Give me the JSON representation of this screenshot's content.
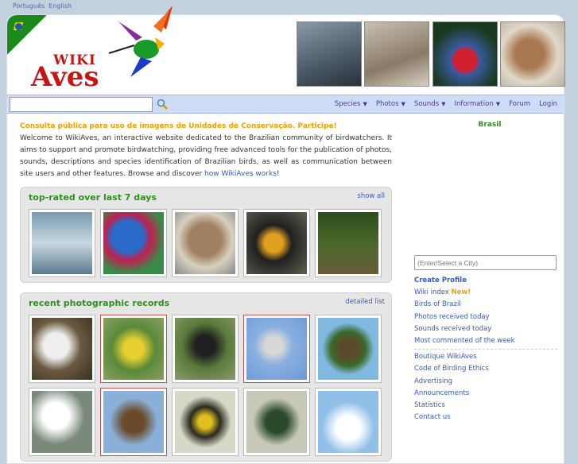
{
  "languages": [
    "Português",
    "English"
  ],
  "logo": {
    "wiki": "WIKI",
    "aves": "Aves"
  },
  "search": {
    "placeholder": ""
  },
  "nav": [
    {
      "label": "Species",
      "dropdown": true
    },
    {
      "label": "Photos",
      "dropdown": true
    },
    {
      "label": "Sounds",
      "dropdown": true
    },
    {
      "label": "Information",
      "dropdown": true
    },
    {
      "label": "Forum",
      "dropdown": false
    },
    {
      "label": "Login",
      "dropdown": false
    }
  ],
  "notice": "Consulta pública para uso de imagens de Unidades de Conservação. Participe!",
  "intro": {
    "text": "Welcome to WikiAves, an interactive website dedicated to the Brazilian community of birdwatchers. It aims to support and promote birdwatching, providing free advanced tools for the publication of photos, sounds, descriptions and species identification of Brazilian birds, as well as communication between site users and other features. Browse and discover ",
    "link": "how WikiAves works",
    "end": "!"
  },
  "top_rated": {
    "title": "top-rated over last 7 days",
    "more": "show all"
  },
  "recent": {
    "title": "recent photographic records",
    "more": "detailed list"
  },
  "right": {
    "region": "Brasil",
    "city_placeholder": "(Enter/Select a City)",
    "create_profile": "Create Profile",
    "wiki_index": "Wiki index",
    "new_badge": "New!",
    "links1": [
      "Birds of Brazil",
      "Photos received today",
      "Sounds received today",
      "Most commented of the week"
    ],
    "links2": [
      "Boutique WikiAves",
      "Code of Birding Ethics",
      "Advertising",
      "Announcements",
      "Statistics",
      "Contact us"
    ]
  },
  "colors": {
    "accent_green": "#2f8f1f",
    "link": "#3a5ab8",
    "notice": "#f0a000"
  }
}
